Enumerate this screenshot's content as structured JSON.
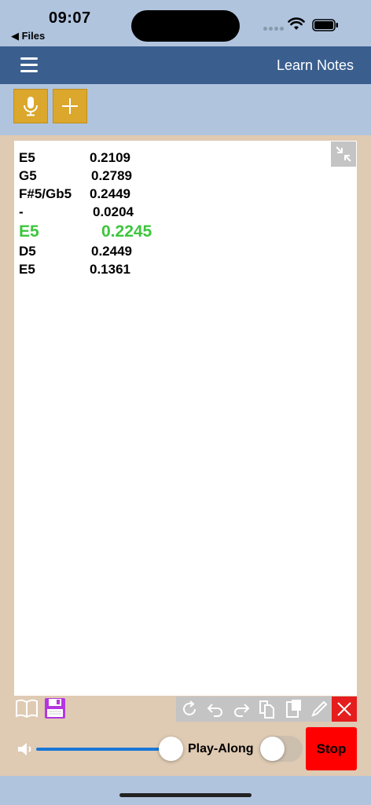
{
  "status_bar": {
    "time": "09:07",
    "back_label": "◀ Files"
  },
  "nav": {
    "title": "Learn Notes"
  },
  "toolbar": {
    "mic_icon": "microphone-icon",
    "add_icon": "plus-icon"
  },
  "notes": [
    {
      "note": "E5",
      "value": "0.2109",
      "active": false
    },
    {
      "note": "G5",
      "value": "0.2789",
      "active": false
    },
    {
      "note": "F#5/Gb5",
      "value": "0.2449",
      "active": false
    },
    {
      "note": "-",
      "value": "0.0204",
      "active": false
    },
    {
      "note": "E5",
      "value": "0.2245",
      "active": true
    },
    {
      "note": "D5",
      "value": "0.2449",
      "active": false
    },
    {
      "note": "E5",
      "value": "0.1361",
      "active": false
    }
  ],
  "controls": {
    "volume": 0.9,
    "play_along_label": "Play-Along",
    "play_along_on": false,
    "stop_label": "Stop"
  },
  "colors": {
    "status_bg": "#b0c4de",
    "nav_bg": "#3a5f8f",
    "accent_button": "#dba72c",
    "body_bg": "#dfcab3",
    "active_note": "#3cc63c",
    "stop": "#ff0000",
    "close": "#e51d1d"
  }
}
